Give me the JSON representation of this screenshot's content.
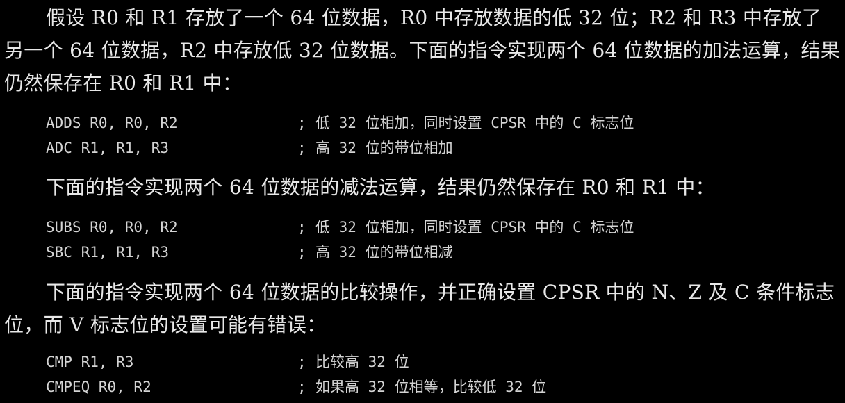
{
  "paragraphs": {
    "p1": "假设 R0 和 R1 存放了一个 64 位数据，R0 中存放数据的低 32 位；R2 和 R3 中存放了另一个 64 位数据，R2 中存放低 32 位数据。下面的指令实现两个 64 位数据的加法运算，结果仍然保存在 R0 和 R1 中：",
    "p2": "下面的指令实现两个 64 位数据的减法运算，结果仍然保存在 R0 和 R1 中：",
    "p3": "下面的指令实现两个 64 位数据的比较操作，并正确设置 CPSR 中的 N、Z 及 C 条件标志位，而 V 标志位的设置可能有错误："
  },
  "code_add": [
    {
      "instruction": "ADDS R0, R0, R2",
      "semicolon": ";",
      "comment": "低 32 位相加，同时设置 CPSR 中的 C 标志位"
    },
    {
      "instruction": "ADC R1, R1, R3",
      "semicolon": ";",
      "comment": "高 32 位的带位相加"
    }
  ],
  "code_sub": [
    {
      "instruction": "SUBS R0, R0, R2",
      "semicolon": ";",
      "comment": "低 32 位相加，同时设置 CPSR 中的 C 标志位"
    },
    {
      "instruction": "SBC R1, R1, R3",
      "semicolon": ";",
      "comment": "高 32 位的带位相减"
    }
  ],
  "code_cmp": [
    {
      "instruction": "CMP R1, R3",
      "semicolon": ";",
      "comment": "比较高 32 位"
    },
    {
      "instruction": "CMPEQ R0, R2",
      "semicolon": ";",
      "comment": "如果高 32 位相等，比较低 32 位"
    }
  ]
}
